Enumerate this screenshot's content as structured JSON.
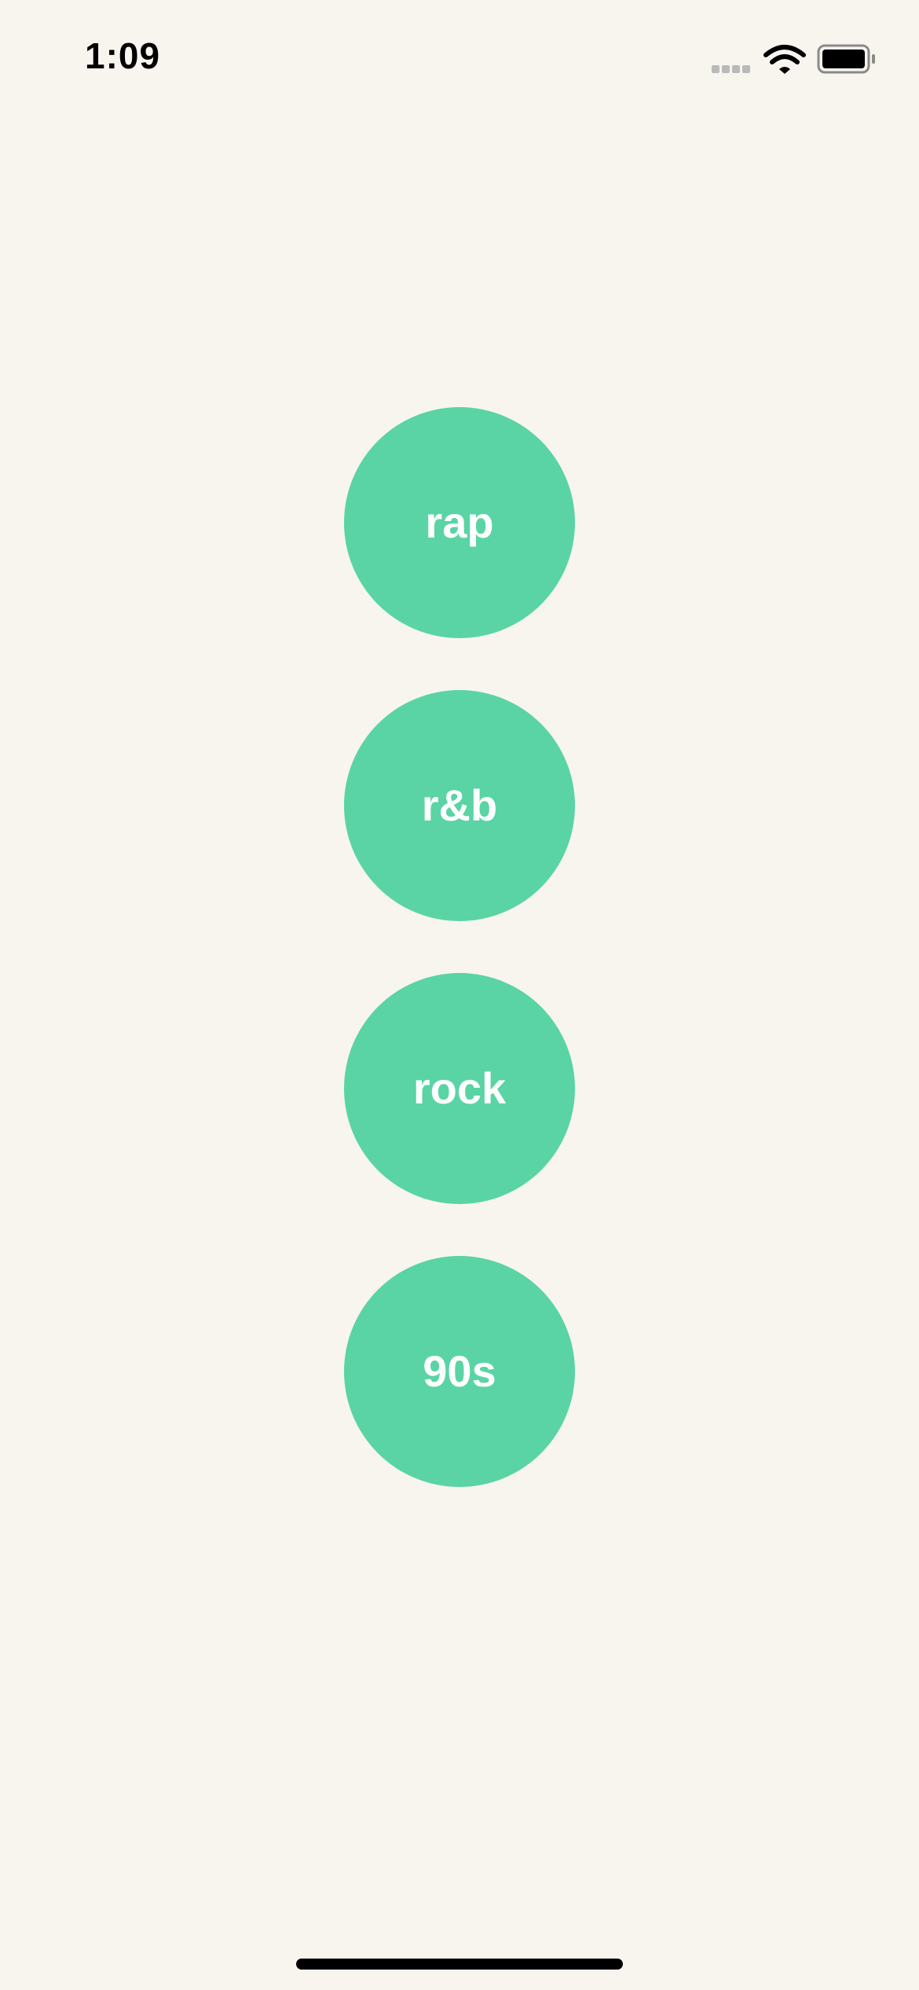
{
  "status_bar": {
    "time": "1:09",
    "icons": [
      "signal-dots-icon",
      "wifi-icon",
      "battery-icon"
    ]
  },
  "genres": [
    {
      "label": "rap"
    },
    {
      "label": "r&b"
    },
    {
      "label": "rock"
    },
    {
      "label": "90s"
    }
  ],
  "colors": {
    "background": "#f8f5ef",
    "button": "#5ad4a4",
    "button_text": "#ffffff"
  }
}
